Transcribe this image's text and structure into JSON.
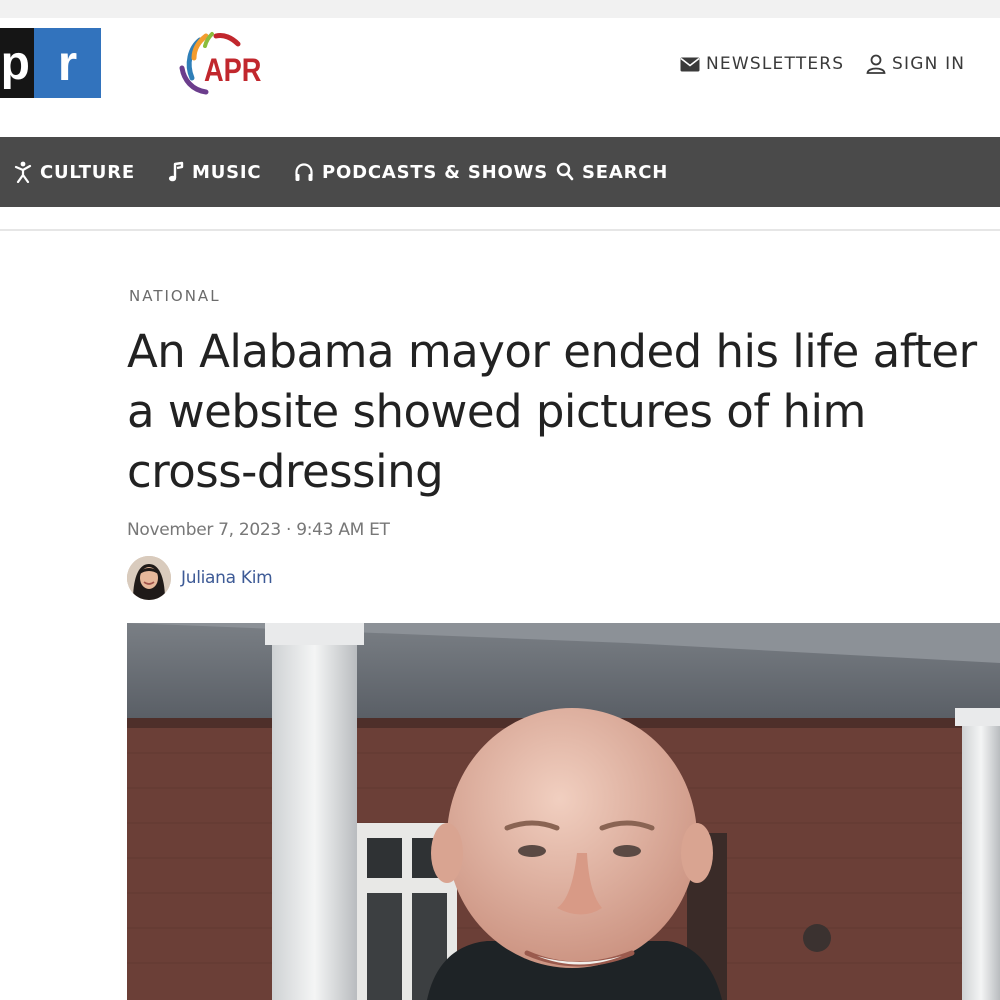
{
  "header": {
    "npr_logo": {
      "left": "p",
      "right": "r"
    },
    "station_logo": {
      "text": "APR"
    },
    "newsletters_label": "NEWSLETTERS",
    "signin_label": "SIGN IN"
  },
  "nav": {
    "items": [
      {
        "label": "CULTURE",
        "icon": "culture-icon"
      },
      {
        "label": "MUSIC",
        "icon": "music-note-icon"
      },
      {
        "label": "PODCASTS & SHOWS",
        "icon": "headphones-icon"
      },
      {
        "label": "SEARCH",
        "icon": "search-icon"
      }
    ]
  },
  "article": {
    "section": "NATIONAL",
    "headline": "An Alabama mayor ended his life after a website showed pictures of him cross-dressing",
    "date": "November 7, 2023 · 9:43 AM ET",
    "author": "Juliana Kim"
  },
  "colors": {
    "nav_background": "#4a4a4a",
    "npr_blue": "#3273bd",
    "apr_red": "#c1272d",
    "byline_link": "#3d5a96"
  }
}
